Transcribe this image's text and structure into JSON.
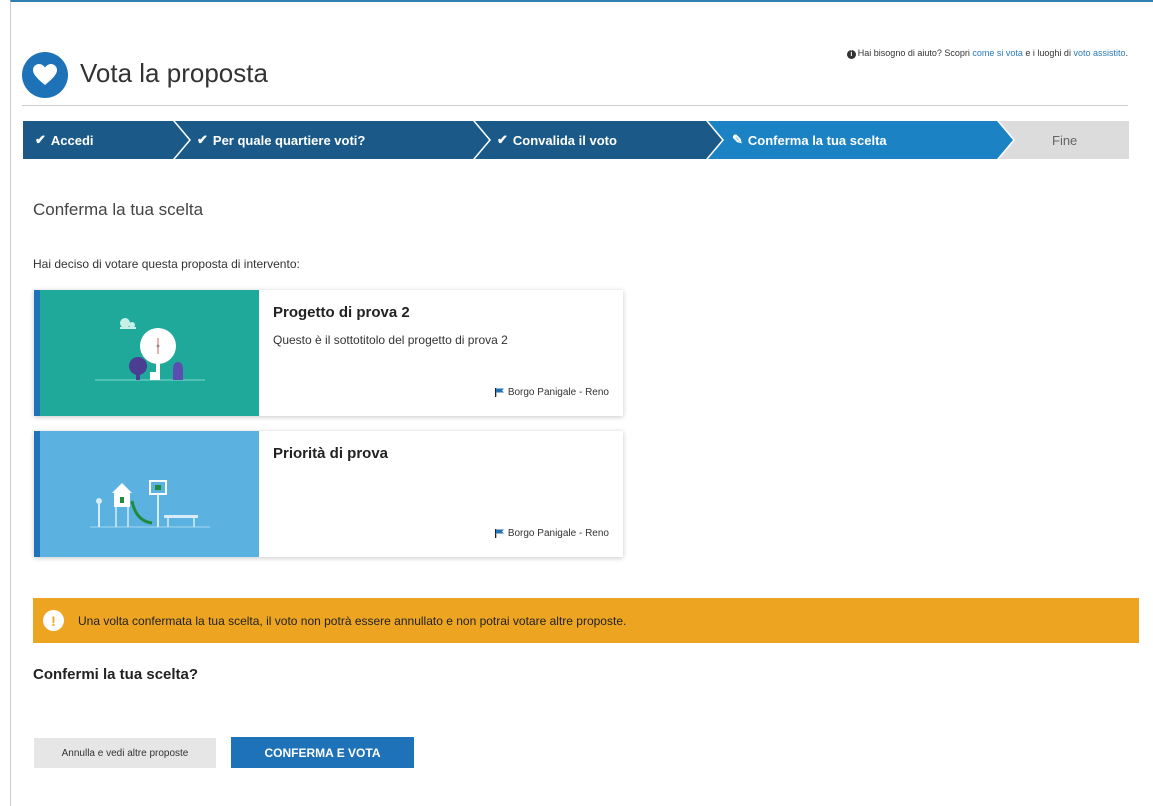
{
  "header": {
    "title": "Vota la proposta",
    "help": {
      "prefix": "Hai bisogno di aiuto? Scopri ",
      "link1": "come si vota",
      "middle": " e i luoghi di ",
      "link2": "voto assistito",
      "suffix": "."
    }
  },
  "steps": [
    {
      "label": "Accedi",
      "state": "done"
    },
    {
      "label": "Per quale quartiere voti?",
      "state": "done"
    },
    {
      "label": "Convalida il voto",
      "state": "done"
    },
    {
      "label": "Conferma la tua scelta",
      "state": "current"
    },
    {
      "label": "Fine",
      "state": "pending"
    }
  ],
  "main": {
    "section_title": "Conferma la tua scelta",
    "intro": "Hai deciso di votare questa proposta di intervento:",
    "cards": [
      {
        "title": "Progetto di prova 2",
        "subtitle": "Questo è il sottotitolo del progetto di prova 2",
        "location": "Borgo Panigale - Reno",
        "image_color": "#1fa99a"
      },
      {
        "title": "Priorità di prova",
        "subtitle": "",
        "location": "Borgo Panigale - Reno",
        "image_color": "#5bb1e0"
      }
    ],
    "warning": "Una volta confermata la tua scelta, il voto non potrà essere annullato e non potrai votare altre proposte.",
    "question": "Confermi la tua scelta?",
    "cancel_label": "Annulla e vedi altre proposte",
    "confirm_label": "CONFERMA E VOTA"
  },
  "colors": {
    "primary": "#1e73b8",
    "step_done": "#1b5a88",
    "step_current": "#1b82c4",
    "step_pending": "#dcdcdc",
    "warning": "#eda521"
  }
}
